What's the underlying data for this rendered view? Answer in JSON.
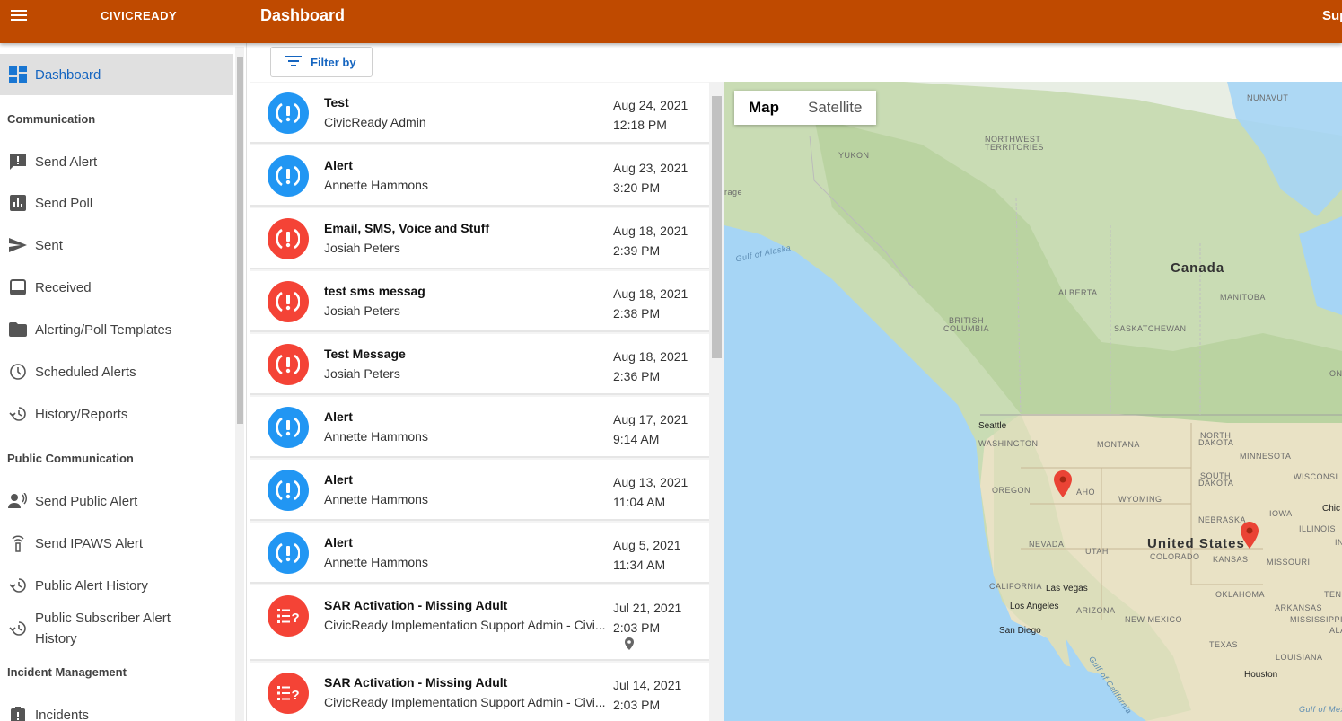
{
  "header": {
    "brand": "CIVICREADY",
    "title": "Dashboard",
    "right_text": "Sup"
  },
  "sidebar": {
    "items": [
      {
        "label": "Dashboard",
        "icon": "dashboard-icon"
      },
      {
        "label": "Send Alert",
        "icon": "alert-message-icon"
      },
      {
        "label": "Send Poll",
        "icon": "poll-icon"
      },
      {
        "label": "Sent",
        "icon": "send-icon"
      },
      {
        "label": "Received",
        "icon": "inbox-icon"
      },
      {
        "label": "Alerting/Poll Templates",
        "icon": "folder-icon"
      },
      {
        "label": "Scheduled Alerts",
        "icon": "clock-icon"
      },
      {
        "label": "History/Reports",
        "icon": "history-icon"
      },
      {
        "label": "Send Public Alert",
        "icon": "public-broadcast-icon"
      },
      {
        "label": "Send IPAWS Alert",
        "icon": "antenna-icon"
      },
      {
        "label": "Public Alert History",
        "icon": "history-icon"
      },
      {
        "label": "Public Subscriber Alert History",
        "label_line1": "Public Subscriber Alert",
        "label_line2": "History",
        "icon": "history-icon"
      },
      {
        "label": "Incidents",
        "icon": "incident-icon"
      }
    ],
    "sections": {
      "communication": "Communication",
      "public_communication": "Public Communication",
      "incident_management": "Incident Management"
    }
  },
  "filter": {
    "label": "Filter by"
  },
  "alerts": [
    {
      "title": "Test",
      "sender": "CivicReady Admin",
      "date": "Aug 24, 2021",
      "time": "12:18 PM",
      "color": "#2196f3",
      "icon": "alert-exclamation-icon"
    },
    {
      "title": "Alert",
      "sender": "Annette Hammons",
      "date": "Aug 23, 2021",
      "time": "3:20 PM",
      "color": "#2196f3",
      "icon": "alert-exclamation-icon"
    },
    {
      "title": "Email, SMS, Voice and Stuff",
      "sender": "Josiah Peters",
      "date": "Aug 18, 2021",
      "time": "2:39 PM",
      "color": "#f44336",
      "icon": "alert-exclamation-icon"
    },
    {
      "title": "test sms messag",
      "sender": "Josiah Peters",
      "date": "Aug 18, 2021",
      "time": "2:38 PM",
      "color": "#f44336",
      "icon": "alert-exclamation-icon"
    },
    {
      "title": "Test Message",
      "sender": "Josiah Peters",
      "date": "Aug 18, 2021",
      "time": "2:36 PM",
      "color": "#f44336",
      "icon": "alert-exclamation-icon"
    },
    {
      "title": "Alert",
      "sender": "Annette Hammons",
      "date": "Aug 17, 2021",
      "time": "9:14 AM",
      "color": "#2196f3",
      "icon": "alert-exclamation-icon"
    },
    {
      "title": "Alert",
      "sender": "Annette Hammons",
      "date": "Aug 13, 2021",
      "time": "11:04 AM",
      "color": "#2196f3",
      "icon": "alert-exclamation-icon"
    },
    {
      "title": "Alert",
      "sender": "Annette Hammons",
      "date": "Aug 5, 2021",
      "time": "11:34 AM",
      "color": "#2196f3",
      "icon": "alert-exclamation-icon"
    },
    {
      "title": "SAR Activation - Missing Adult",
      "sender": "CivicReady Implementation Support Admin - Civi...",
      "date": "Jul 21, 2021",
      "time": "2:03 PM",
      "color": "#f44336",
      "icon": "poll-list-icon",
      "has_location": true
    },
    {
      "title": "SAR Activation - Missing Adult",
      "sender": "CivicReady Implementation Support Admin - Civi...",
      "date": "Jul 14, 2021",
      "time": "2:03 PM",
      "color": "#f44336",
      "icon": "poll-list-icon"
    }
  ],
  "map": {
    "toggle": {
      "map": "Map",
      "satellite": "Satellite"
    },
    "labels": {
      "nunavut": "NUNAVUT",
      "northwest1": "NORTHWEST",
      "northwest2": "TERRITORIES",
      "yukon": "YUKON",
      "gulf_alaska": "Gulf of Alaska",
      "canada": "Canada",
      "alberta": "ALBERTA",
      "manitoba": "MANITOBA",
      "bc1": "BRITISH",
      "bc2": "COLUMBIA",
      "saskatchewan": "SASKATCHEWAN",
      "seattle": "Seattle",
      "washington": "WASHINGTON",
      "montana": "MONTANA",
      "north_dakota1": "NORTH",
      "north_dakota2": "DAKOTA",
      "minnesota": "MINNESOTA",
      "oregon": "OREGON",
      "idaho": "AHO",
      "wyoming": "WYOMING",
      "south_dakota1": "SOUTH",
      "south_dakota2": "DAKOTA",
      "wisconsin": "WISCONSI",
      "nebraska": "NEBRASKA",
      "iowa": "IOWA",
      "nevada": "NEVADA",
      "utah": "UTAH",
      "united_states": "United States",
      "colorado": "COLORADO",
      "kansas": "KANSAS",
      "missouri": "MISSOURI",
      "california": "CALIFORNIA",
      "las_vegas": "Las Vegas",
      "oklahoma": "OKLAHOMA",
      "los_angeles": "Los Angeles",
      "arizona": "ARIZONA",
      "new_mexico": "NEW MEXICO",
      "arkansas": "ARKANSAS",
      "san_diego": "San Diego",
      "texas": "TEXAS",
      "louisiana": "LOUISIANA",
      "houston": "Houston",
      "gulf_california": "Gulf of California",
      "gulf_mexico": "Gulf of Mexico",
      "anchorage": "rage",
      "chicago": "Chic",
      "ontario": "ON",
      "illinois": "ILLINOIS",
      "tennessee": "TENN",
      "mississippi": "MISSISSIPPI",
      "alabama": "ALA",
      "indiana": "IN"
    },
    "pin_color": "#ea4335"
  }
}
